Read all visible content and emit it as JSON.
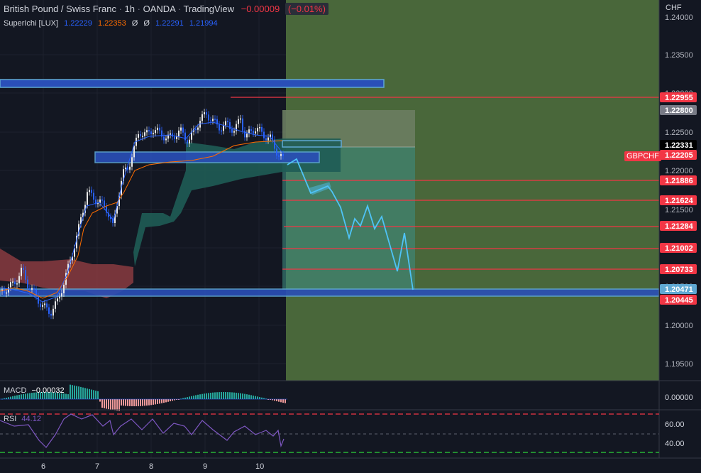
{
  "header": {
    "symbol": "British Pound / Swiss Franc",
    "interval": "1h",
    "broker": "OANDA",
    "platform": "TradingView",
    "change": "−0.00009",
    "change_pct": "(−0.01%)"
  },
  "indicator": {
    "name": "SuperIchi [LUX]",
    "values": [
      "1.22229",
      "1.22353",
      "Ø",
      "Ø",
      "1.22291",
      "1.21994"
    ]
  },
  "currency": "CHF",
  "symbol_tag": "GBPCHF",
  "price_axis": {
    "ticks": [
      "1.24000",
      "1.23500",
      "1.23000",
      "1.22500",
      "1.22000",
      "1.21500",
      "1.21000",
      "1.20500",
      "1.20000",
      "1.19500"
    ],
    "tags": [
      {
        "text": "1.22955",
        "color": "#f23645"
      },
      {
        "text": "1.22800",
        "color": "#787b86"
      },
      {
        "text": "1.22331",
        "color": "#000000"
      },
      {
        "text": "1.22205",
        "color": "#f23645"
      },
      {
        "text": "1.21886",
        "color": "#f23645"
      },
      {
        "text": "1.21624",
        "color": "#f23645"
      },
      {
        "text": "1.21284",
        "color": "#f23645"
      },
      {
        "text": "1.21002",
        "color": "#f23645"
      },
      {
        "text": "1.20733",
        "color": "#f23645"
      },
      {
        "text": "1.20471",
        "color": "#5fa8d3"
      },
      {
        "text": "1.20445",
        "color": "#f23645"
      }
    ]
  },
  "macd": {
    "label": "MACD",
    "value": "−0.00032",
    "axis_tick": "0.00000"
  },
  "rsi": {
    "label": "RSI",
    "value": "44.12",
    "axis_ticks": [
      "60.00",
      "40.00"
    ]
  },
  "time_axis": [
    "6",
    "7",
    "8",
    "9",
    "10"
  ],
  "colors": {
    "background": "#131722",
    "target_zone": "#4c6b3c",
    "red_level": "#f23645",
    "blue_zone": "#2962ff",
    "cyan": "#4fc3f7",
    "cloud_red": "#8a3b3f",
    "cloud_teal": "#1f5c55"
  }
}
